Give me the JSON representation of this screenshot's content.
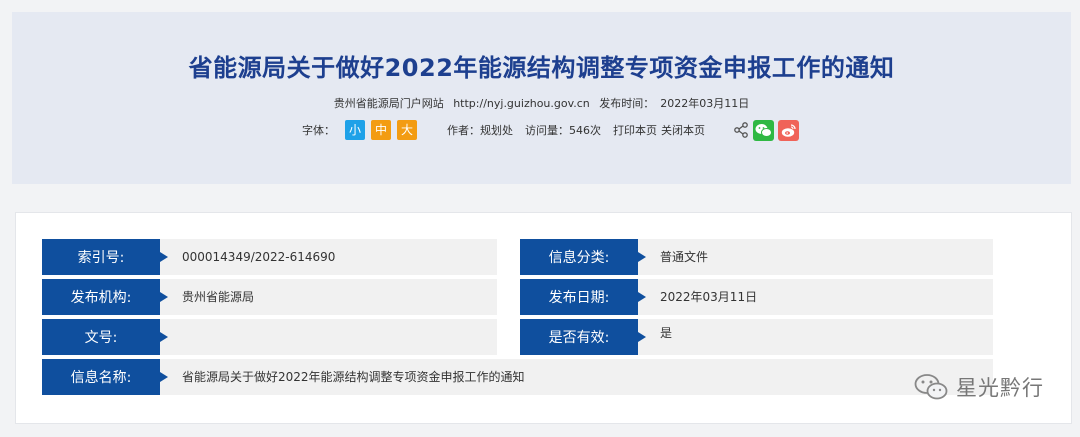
{
  "header": {
    "title": "省能源局关于做好2022年能源结构调整专项资金申报工作的通知",
    "source": "贵州省能源局门户网站",
    "url": "http://nyj.guizhou.gov.cn",
    "publish_label": "发布时间：",
    "publish_date": "2022年03月11日"
  },
  "toolbar": {
    "font_label": "字体：",
    "font_small": "小",
    "font_mid": "中",
    "font_large": "大",
    "author": "作者：规划处",
    "visits": "访问量：546次",
    "print": "打印本页",
    "close": "关闭本页"
  },
  "info": {
    "index_label": "索引号:",
    "index_value": "000014349/2022-614690",
    "category_label": "信息分类:",
    "category_value": "普通文件",
    "publisher_label": "发布机构:",
    "publisher_value": "贵州省能源局",
    "date_label": "发布日期:",
    "date_value": "2022年03月11日",
    "docno_label": "文号:",
    "docno_value": "",
    "valid_label": "是否有效:",
    "valid_value": "是",
    "name_label": "信息名称:",
    "name_value": "省能源局关于做好2022年能源结构调整专项资金申报工作的通知"
  },
  "watermark": {
    "text": "星光黔行"
  },
  "colors": {
    "label_bg": "#0f4f9e",
    "title": "#1d3f8f",
    "header_bg": "#e5e9f2"
  }
}
